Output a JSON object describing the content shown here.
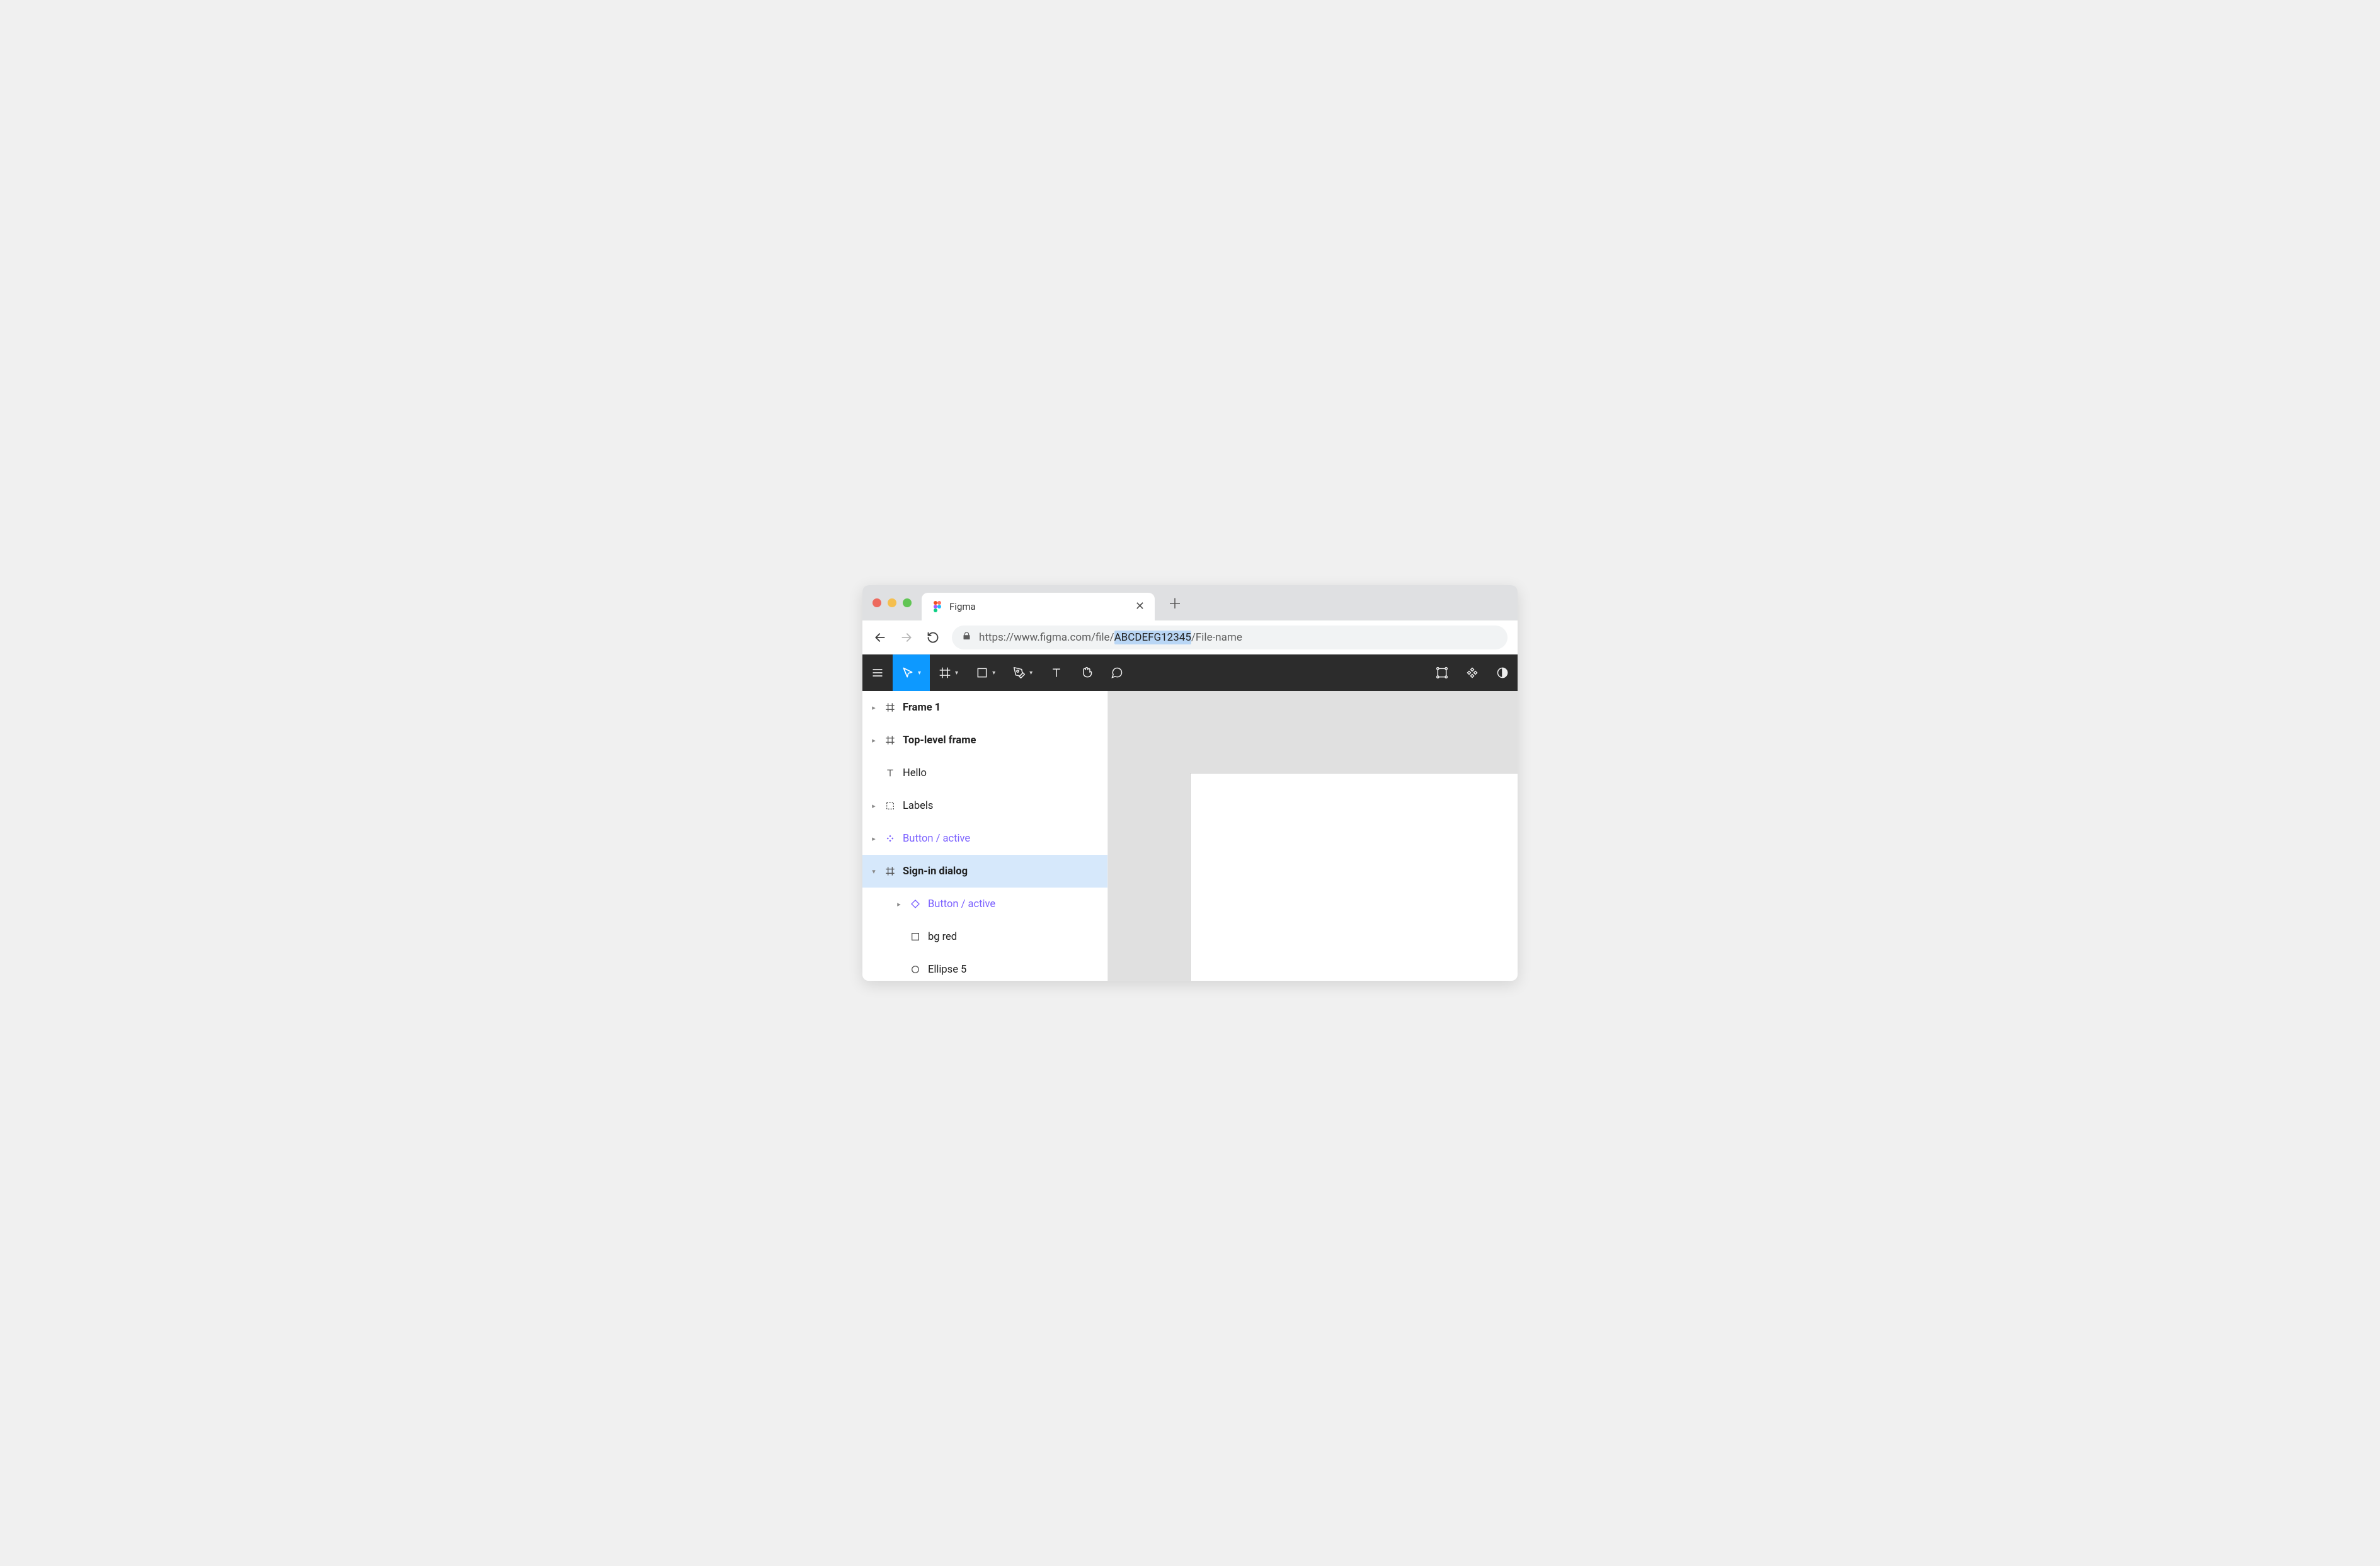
{
  "browser": {
    "tab_title": "Figma",
    "url_prefix": "https://www.figma.com/file/",
    "url_highlight": "ABCDEFG12345",
    "url_suffix": "/File-name"
  },
  "toolbar": {
    "tools": [
      "menu",
      "move",
      "frame",
      "rectangle",
      "pen",
      "text",
      "hand",
      "comment"
    ],
    "right_tools": [
      "components",
      "plugins",
      "dark"
    ]
  },
  "layers": [
    {
      "id": "frame1",
      "label": "Frame 1",
      "icon": "frame",
      "bold": true,
      "expandable": true,
      "expanded": false,
      "depth": 0
    },
    {
      "id": "toplevel",
      "label": "Top-level frame",
      "icon": "frame",
      "bold": true,
      "expandable": true,
      "expanded": false,
      "depth": 0
    },
    {
      "id": "hello",
      "label": "Hello",
      "icon": "text",
      "bold": false,
      "expandable": false,
      "expanded": false,
      "depth": 0
    },
    {
      "id": "labels",
      "label": "Labels",
      "icon": "group",
      "bold": false,
      "expandable": true,
      "expanded": false,
      "depth": 0
    },
    {
      "id": "btnA",
      "label": "Button / active",
      "icon": "component",
      "bold": false,
      "expandable": true,
      "expanded": false,
      "depth": 0,
      "component": true
    },
    {
      "id": "signin",
      "label": "Sign-in dialog",
      "icon": "frame",
      "bold": true,
      "expandable": true,
      "expanded": true,
      "depth": 0,
      "selected": true
    },
    {
      "id": "btnB",
      "label": "Button / active",
      "icon": "instance",
      "bold": false,
      "expandable": true,
      "expanded": false,
      "depth": 1,
      "component": true
    },
    {
      "id": "bgred",
      "label": "bg red",
      "icon": "rect",
      "bold": false,
      "expandable": false,
      "expanded": false,
      "depth": 1
    },
    {
      "id": "ellipse5",
      "label": "Ellipse 5",
      "icon": "ellipse",
      "bold": false,
      "expandable": false,
      "expanded": false,
      "depth": 1
    }
  ]
}
